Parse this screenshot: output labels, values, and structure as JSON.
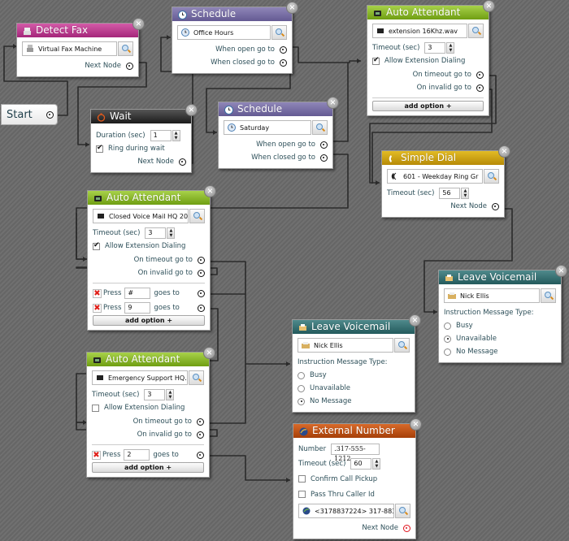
{
  "start": {
    "label": "Start"
  },
  "nodes": {
    "detect_fax": {
      "title": "Detect Fax",
      "value": "Virtual Fax Machine",
      "next": "Next Node"
    },
    "schedule1": {
      "title": "Schedule",
      "value": "Office Hours",
      "open": "When open go to",
      "closed": "When closed go to"
    },
    "schedule2": {
      "title": "Schedule",
      "value": "Saturday",
      "open": "When open go to",
      "closed": "When closed go to"
    },
    "wait": {
      "title": "Wait",
      "duration_label": "Duration (sec)",
      "duration": "1",
      "ring_label": "Ring during wait",
      "ring_checked": true,
      "next": "Next Node"
    },
    "aa1": {
      "title": "Auto Attendant",
      "value": "extension 16Khz.wav",
      "timeout_label": "Timeout (sec)",
      "timeout": "3",
      "ext_label": "Allow Extension Dialing",
      "ext_checked": true,
      "on_timeout": "On timeout go to",
      "on_invalid": "On invalid go to",
      "add": "add option +"
    },
    "dial": {
      "title": "Simple Dial",
      "value": "601 - Weekday Ring Gr",
      "timeout_label": "Timeout (sec)",
      "timeout": "56",
      "next": "Next Node"
    },
    "aa2": {
      "title": "Auto Attendant",
      "value": "Closed Voice Mail HQ 20",
      "timeout_label": "Timeout (sec)",
      "timeout": "3",
      "ext_label": "Allow Extension Dialing",
      "ext_checked": true,
      "on_timeout": "On timeout go to",
      "on_invalid": "On invalid go to",
      "options": [
        {
          "press": "Press",
          "key": "#",
          "goes": "goes to"
        },
        {
          "press": "Press",
          "key": "9",
          "goes": "goes to"
        }
      ],
      "add": "add option +"
    },
    "aa3": {
      "title": "Auto Attendant",
      "value": "Emergency Support HQ.",
      "timeout_label": "Timeout (sec)",
      "timeout": "3",
      "ext_label": "Allow Extension Dialing",
      "ext_checked": false,
      "on_timeout": "On timeout go to",
      "on_invalid": "On invalid go to",
      "options": [
        {
          "press": "Press",
          "key": "2",
          "goes": "goes to"
        }
      ],
      "add": "add option +"
    },
    "vm1": {
      "title": "Leave Voicemail",
      "value": "Nick Ellis",
      "type_label": "Instruction Message Type:",
      "options": [
        "Busy",
        "Unavailable",
        "No Message"
      ],
      "selected": "Unavailable"
    },
    "vm2": {
      "title": "Leave Voicemail",
      "value": "Nick Ellis",
      "type_label": "Instruction Message Type:",
      "options": [
        "Busy",
        "Unavailable",
        "No Message"
      ],
      "selected": "No Message"
    },
    "ext": {
      "title": "External Number",
      "number_label": "Number",
      "number": ".317-555-1212",
      "timeout_label": "Timeout (sec)",
      "timeout": "60",
      "confirm_label": "Confirm Call Pickup",
      "passthru_label": "Pass Thru Caller Id",
      "caller": "<3178837224> 317-883",
      "next": "Next Node"
    }
  },
  "colors": {
    "fax": "#b8338a",
    "schedule": "#716aa0",
    "auto_attendant": "#86b520",
    "wait": "#2a2a2a",
    "simple_dial": "#c99c0c",
    "voicemail": "#2e6668",
    "external": "#b84d12",
    "unconnected_port": "#e0101a"
  }
}
